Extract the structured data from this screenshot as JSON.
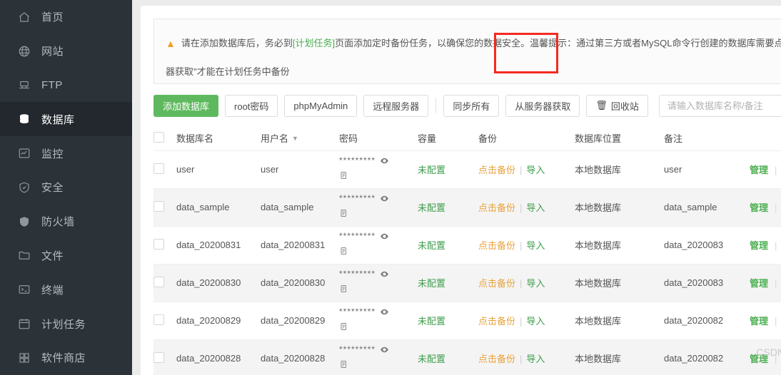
{
  "sidebar": {
    "items": [
      {
        "label": "首页",
        "icon": "home-icon",
        "active": false
      },
      {
        "label": "网站",
        "icon": "globe-icon",
        "active": false
      },
      {
        "label": "FTP",
        "icon": "ftp-icon",
        "active": false
      },
      {
        "label": "数据库",
        "icon": "database-icon",
        "active": true
      },
      {
        "label": "监控",
        "icon": "monitor-icon",
        "active": false
      },
      {
        "label": "安全",
        "icon": "shield-check-icon",
        "active": false
      },
      {
        "label": "防火墙",
        "icon": "shield-filled-icon",
        "active": false
      },
      {
        "label": "文件",
        "icon": "folder-icon",
        "active": false
      },
      {
        "label": "终端",
        "icon": "terminal-icon",
        "active": false
      },
      {
        "label": "计划任务",
        "icon": "calendar-icon",
        "active": false
      },
      {
        "label": "软件商店",
        "icon": "grid-icon",
        "active": false
      }
    ]
  },
  "notice": {
    "icon": "warning-triangle-icon",
    "text_before": "请在添加数据库后，务必到",
    "link_text": "[计划任务]",
    "text_after": "页面添加定时备份任务，以确保您的数据安全。温馨提示：通过第三方或者MySQL命令行创建的数据库需要点击\"从服务",
    "line2": "器获取\"才能在计划任务中备份"
  },
  "toolbar": {
    "add_db": "添加数据库",
    "root_password": "root密码",
    "phpmyadmin": "phpMyAdmin",
    "remote_server": "远程服务器",
    "sync_all": "同步所有",
    "fetch_from_server": "从服务器获取",
    "recycle_bin": "回收站",
    "recycle_icon": "trash-icon",
    "search_placeholder": "请输入数据库名称/备注"
  },
  "table": {
    "headers": {
      "checkbox": "select-all",
      "name": "数据库名",
      "username": "用户名",
      "sort_icon": "sort-desc-icon",
      "password": "密码",
      "size": "容量",
      "backup": "备份",
      "location": "数据库位置",
      "note": "备注"
    },
    "password_mask": "*********",
    "eye_icon": "eye-icon",
    "copy_icon": "copy-icon",
    "backup_label": "点击备份",
    "import_label": "导入",
    "manage_label": "管理",
    "rows": [
      {
        "name": "user",
        "username": "user",
        "size": "未配置",
        "location": "本地数据库",
        "note": "user"
      },
      {
        "name": "data_sample",
        "username": "data_sample",
        "size": "未配置",
        "location": "本地数据库",
        "note": "data_sample"
      },
      {
        "name": "data_20200831",
        "username": "data_20200831",
        "size": "未配置",
        "location": "本地数据库",
        "note": "data_2020083"
      },
      {
        "name": "data_20200830",
        "username": "data_20200830",
        "size": "未配置",
        "location": "本地数据库",
        "note": "data_2020083"
      },
      {
        "name": "data_20200829",
        "username": "data_20200829",
        "size": "未配置",
        "location": "本地数据库",
        "note": "data_2020082"
      },
      {
        "name": "data_20200828",
        "username": "data_20200828",
        "size": "未配置",
        "location": "本地数据库",
        "note": "data_2020082"
      }
    ]
  },
  "annotation": {
    "highlight_color": "#f52a20"
  },
  "watermark": {
    "text": "CSDN @嚶桃子"
  }
}
